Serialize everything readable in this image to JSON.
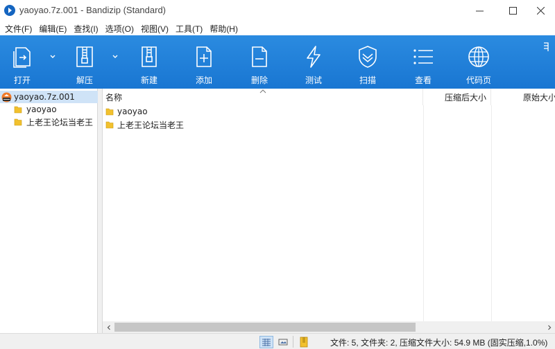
{
  "window": {
    "title": "yaoyao.7z.001 - Bandizip (Standard)"
  },
  "menu": [
    "文件(F)",
    "编辑(E)",
    "查找(I)",
    "选项(O)",
    "视图(V)",
    "工具(T)",
    "帮助(H)"
  ],
  "toolbar": {
    "open": "打开",
    "extract": "解压",
    "new": "新建",
    "add": "添加",
    "delete": "删除",
    "test": "测试",
    "scan": "扫描",
    "view": "查看",
    "codepage": "代码页"
  },
  "tree": {
    "root": "yaoyao.7z.001",
    "children": [
      "yaoyao",
      "上老王论坛当老王"
    ]
  },
  "list": {
    "columns": {
      "name": "名称",
      "compressed": "压缩后大小",
      "original": "原始大小"
    },
    "rows": [
      {
        "name": "yaoyao"
      },
      {
        "name": "上老王论坛当老王"
      }
    ]
  },
  "status": {
    "text": "文件: 5, 文件夹: 2, 压缩文件大小: 54.9 MB (固实压缩,1.0%)"
  },
  "colors": {
    "toolbar": "#1976d2",
    "selection": "#cfe3f7",
    "folder": "#f2c12e"
  }
}
